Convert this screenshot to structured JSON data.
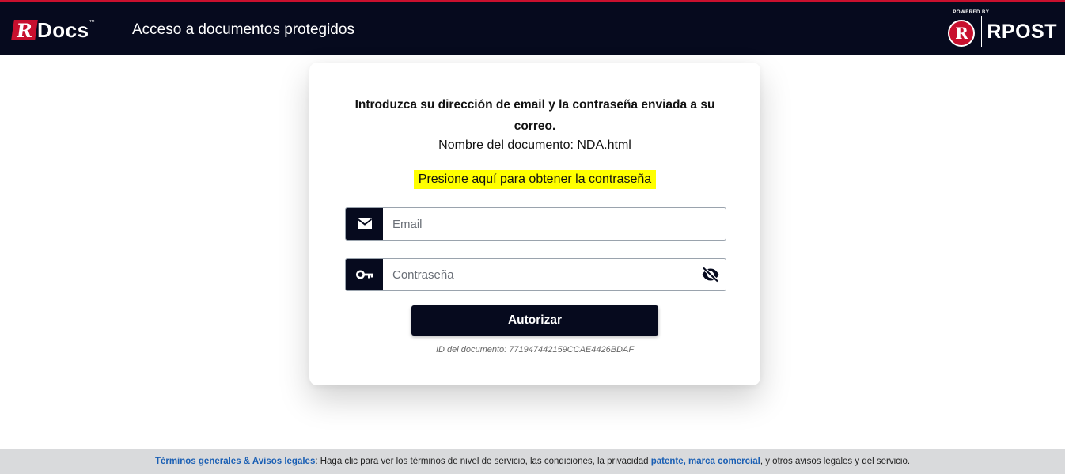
{
  "header": {
    "logo_letter": "R",
    "logo_text": "Docs",
    "logo_tm": "™",
    "title": "Acceso a documentos protegidos",
    "powered_by": "POWERED BY",
    "rpost_letter": "R",
    "rpost_text": "RPOST"
  },
  "card": {
    "prompt": "Introduzca su dirección de email y la contraseña enviada a su correo.",
    "document_name": "Nombre del documento: NDA.html",
    "get_password_link": "Presione aquí para obtener la contraseña",
    "email_placeholder": "Email",
    "password_placeholder": "Contraseña",
    "authorize_button": "Autorizar",
    "document_id": "ID del documento: 771947442159CCAE4426BDAF"
  },
  "icons": {
    "email": "envelope-icon",
    "password": "key-icon",
    "toggle": "eye-off-icon"
  },
  "footer": {
    "terms_link": "Términos generales & Avisos legales",
    "text_1": ": Haga clic para ver los términos de nivel de servicio, las condiciones, la privacidad ",
    "patent_link": "patente, marca comercial",
    "text_2": ", y otros avisos legales y del servicio."
  },
  "colors": {
    "header_bg": "#060a1e",
    "brand_red": "#c8102e",
    "highlight": "#ffff00",
    "link": "#1a5fb4"
  }
}
